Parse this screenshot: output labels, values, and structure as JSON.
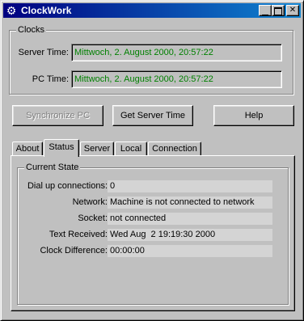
{
  "window": {
    "title": "ClockWork",
    "icon": "clock-icon"
  },
  "clocks": {
    "group_title": "Clocks",
    "server_time_label": "Server Time:",
    "server_time_value": "Mittwoch, 2. August 2000, 20:57:22",
    "pc_time_label": "PC Time:",
    "pc_time_value": "Mittwoch, 2. August 2000, 20:57:22",
    "value_color": "#008000"
  },
  "buttons": {
    "synchronize": "Synchronize PC",
    "get_server_time": "Get Server Time",
    "help": "Help"
  },
  "tabs": [
    {
      "label": "About"
    },
    {
      "label": "Status"
    },
    {
      "label": "Server"
    },
    {
      "label": "Local"
    },
    {
      "label": "Connection"
    }
  ],
  "active_tab": "Status",
  "status": {
    "group_title": "Current State",
    "rows": [
      {
        "label": "Dial up connections:",
        "value": "0"
      },
      {
        "label": "Network:",
        "value": "Machine is not connected to network"
      },
      {
        "label": "Socket:",
        "value": "not connected"
      },
      {
        "label": "Text Received:",
        "value": "Wed Aug  2 19:19:30 2000"
      },
      {
        "label": "Clock Difference:",
        "value": "00:00:00"
      }
    ]
  }
}
